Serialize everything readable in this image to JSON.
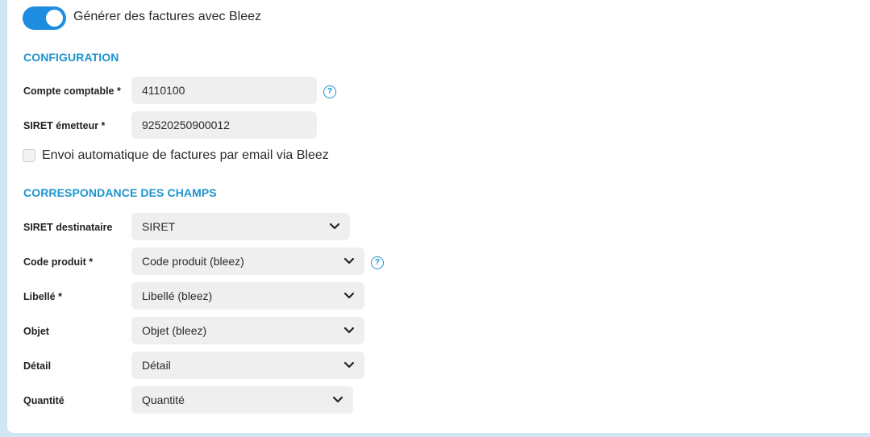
{
  "toggle": {
    "label": "Générer des factures avec Bleez",
    "state": "on",
    "color": "#1e8de0"
  },
  "configuration": {
    "title": "CONFIGURATION",
    "fields": [
      {
        "label": "Compte comptable *",
        "value": "4110100",
        "help_icon": "question-circle-icon"
      },
      {
        "label": "SIRET émetteur *",
        "value": "92520250900012"
      }
    ],
    "checkbox": {
      "label": "Envoi automatique de factures par email via Bleez",
      "checked": false
    }
  },
  "mapping": {
    "title": "CORRESPONDANCE DES CHAMPS",
    "rows": [
      {
        "label": "SIRET destinataire",
        "value": "SIRET"
      },
      {
        "label": "Code produit *",
        "value": "Code produit (bleez)",
        "help_icon": "question-circle-icon"
      },
      {
        "label": "Libellé *",
        "value": "Libellé (bleez)"
      },
      {
        "label": "Objet",
        "value": "Objet (bleez)"
      },
      {
        "label": "Détail",
        "value": "Détail"
      },
      {
        "label": "Quantité",
        "value": "Quantité"
      }
    ]
  },
  "icons": {
    "help": "?",
    "chevron": "chevron-down-icon"
  },
  "colors": {
    "accent": "#1e94cf",
    "toggle": "#1e8de0",
    "field_bg": "#efefef"
  }
}
